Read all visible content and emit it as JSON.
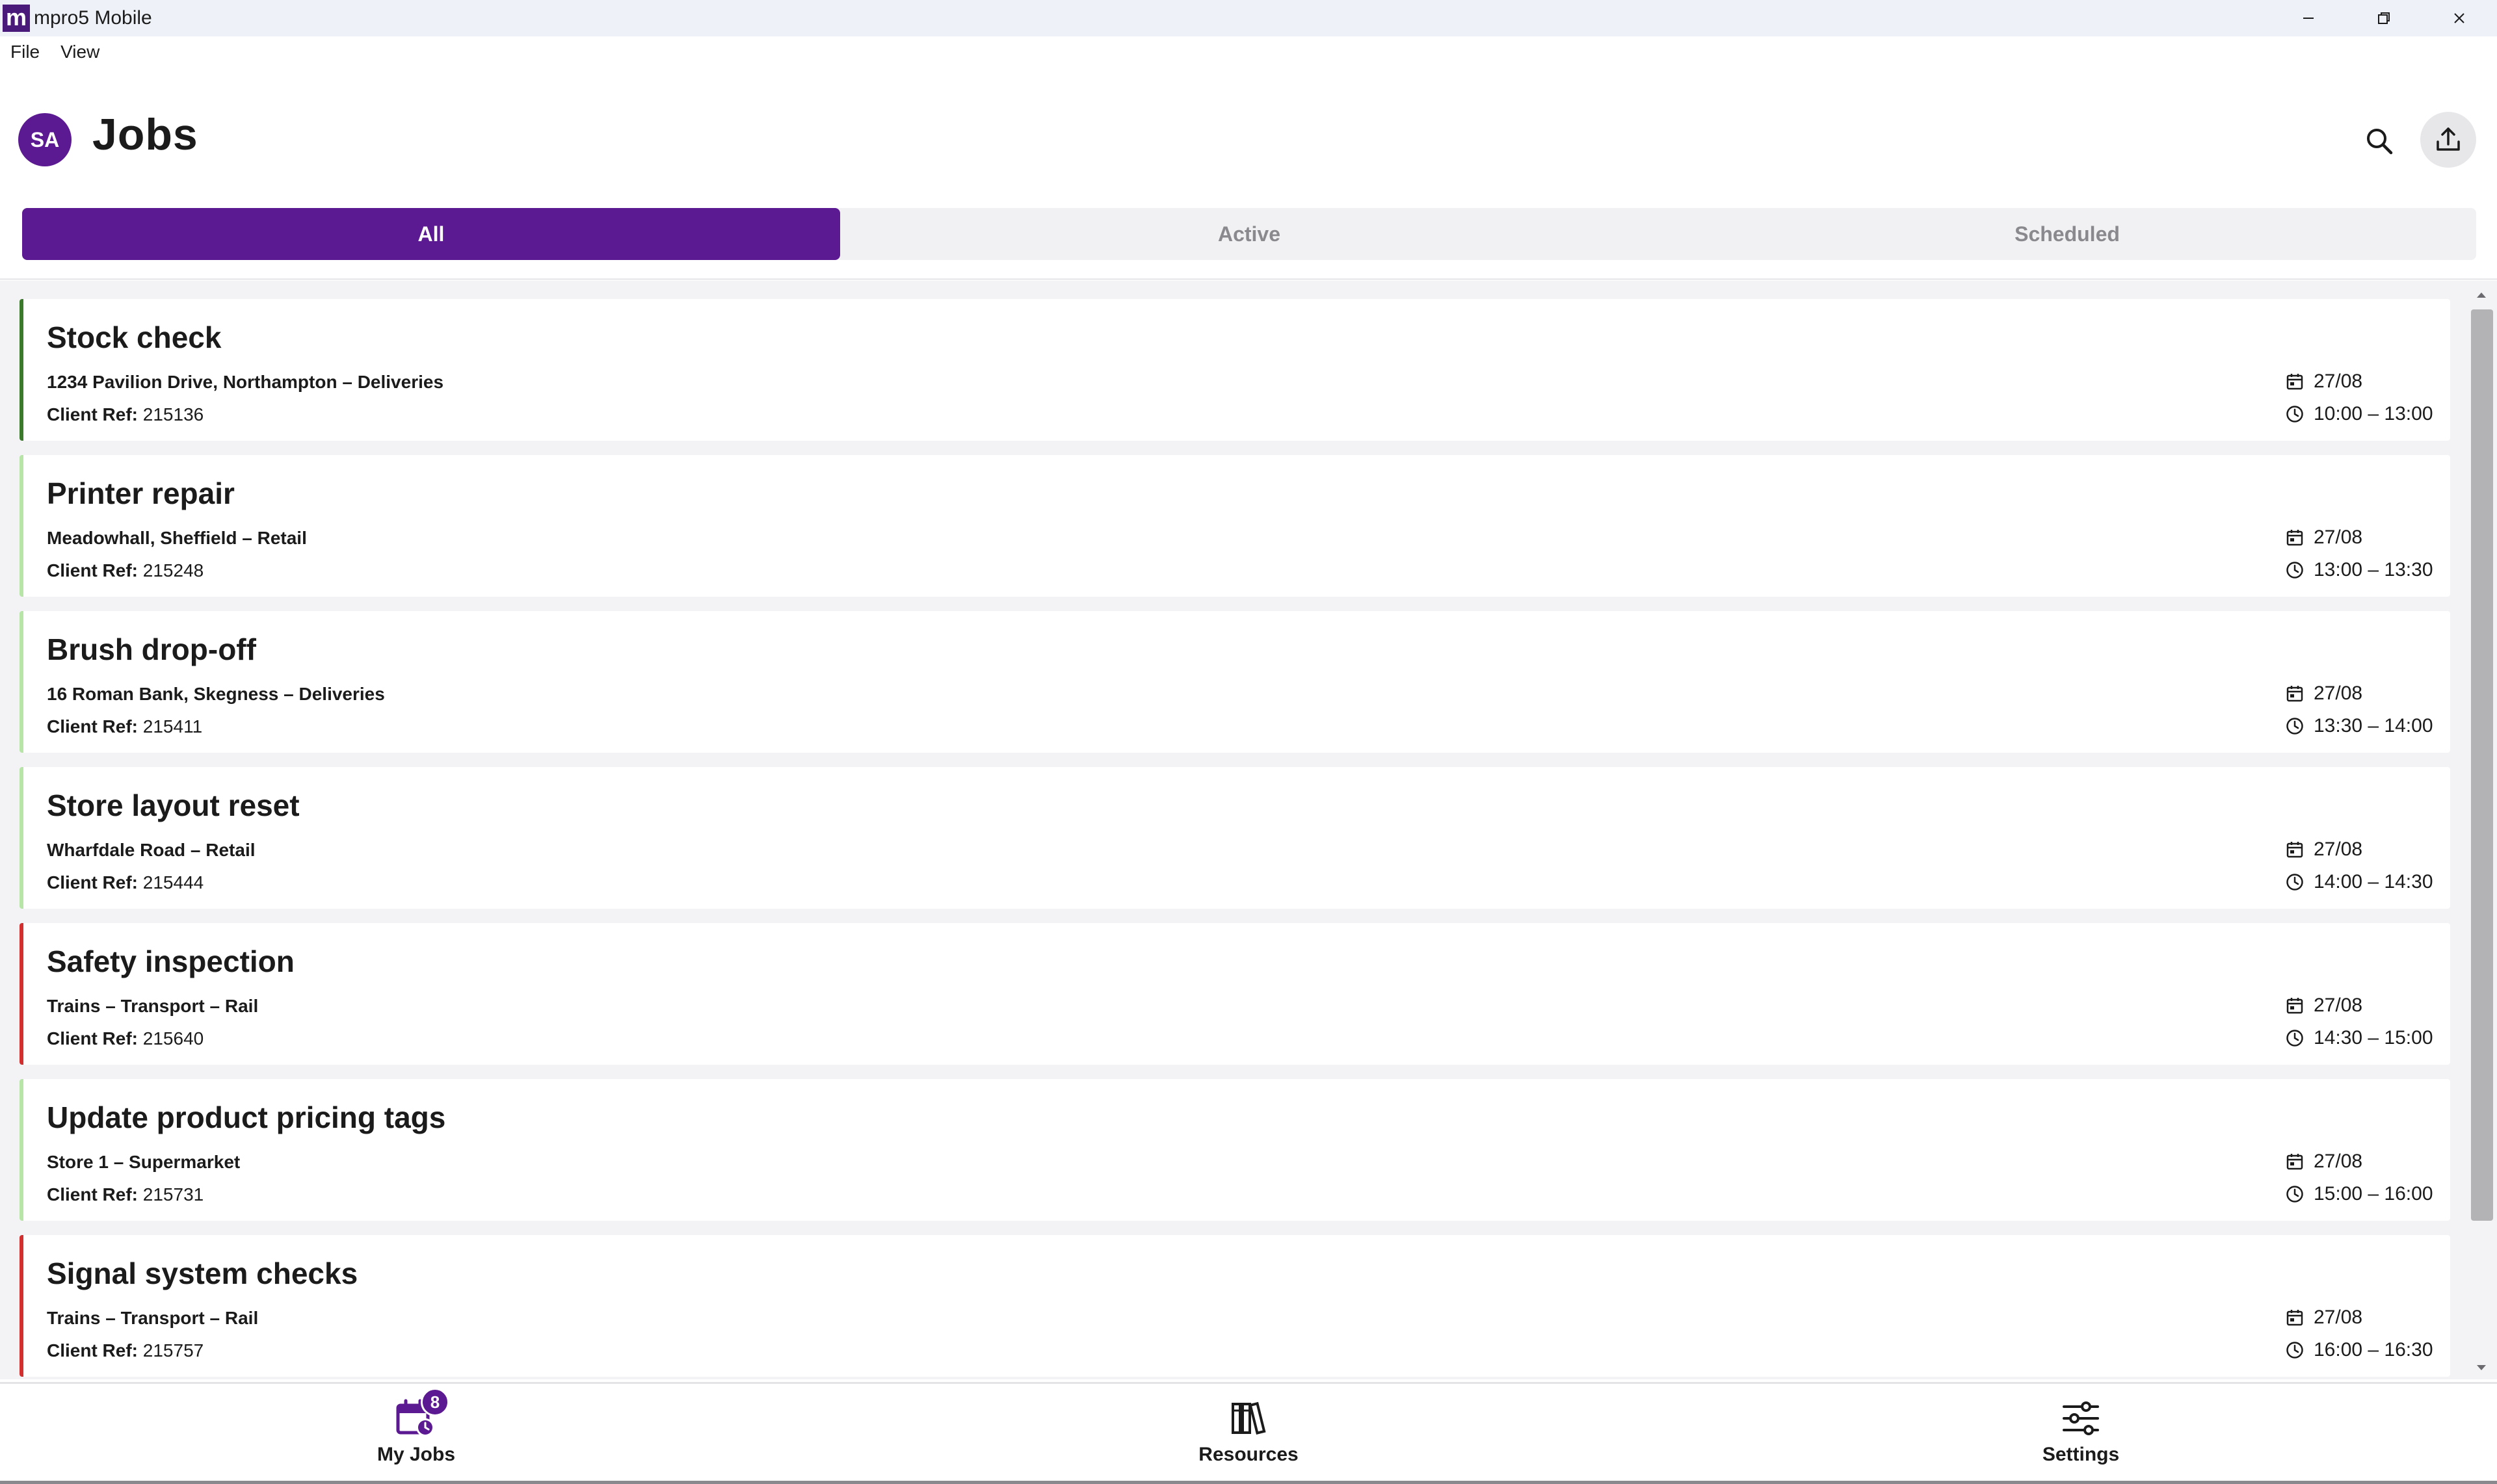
{
  "window": {
    "logo_letter": "m",
    "title": "mpro5 Mobile"
  },
  "menu": [
    "File",
    "View"
  ],
  "header": {
    "avatar_initials": "SA",
    "title": "Jobs"
  },
  "tabs": [
    {
      "label": "All",
      "active": true
    },
    {
      "label": "Active",
      "active": false
    },
    {
      "label": "Scheduled",
      "active": false
    }
  ],
  "client_ref_label": "Client Ref:",
  "jobs": [
    {
      "title": "Stock check",
      "location": "1234 Pavilion Drive, Northampton – Deliveries",
      "client_ref": "215136",
      "date": "27/08",
      "time": "10:00 – 13:00",
      "status_color": "#3a7a2a"
    },
    {
      "title": "Printer repair",
      "location": "Meadowhall, Sheffield – Retail",
      "client_ref": "215248",
      "date": "27/08",
      "time": "13:00 – 13:30",
      "status_color": "#b7e4a7"
    },
    {
      "title": "Brush drop-off",
      "location": "16 Roman Bank, Skegness – Deliveries",
      "client_ref": "215411",
      "date": "27/08",
      "time": "13:30 – 14:00",
      "status_color": "#b7e4a7"
    },
    {
      "title": "Store layout reset",
      "location": "Wharfdale Road – Retail",
      "client_ref": "215444",
      "date": "27/08",
      "time": "14:00 – 14:30",
      "status_color": "#b7e4a7"
    },
    {
      "title": "Safety inspection",
      "location": "Trains – Transport – Rail",
      "client_ref": "215640",
      "date": "27/08",
      "time": "14:30 – 15:00",
      "status_color": "#d32f2f"
    },
    {
      "title": "Update product pricing tags",
      "location": "Store 1 – Supermarket",
      "client_ref": "215731",
      "date": "27/08",
      "time": "15:00 – 16:00",
      "status_color": "#b7e4a7"
    },
    {
      "title": "Signal system checks",
      "location": "Trains – Transport – Rail",
      "client_ref": "215757",
      "date": "27/08",
      "time": "16:00 – 16:30",
      "status_color": "#d32f2f"
    }
  ],
  "bottom_nav": [
    {
      "label": "My Jobs",
      "icon": "calendar-clock-icon",
      "badge": "8",
      "active": true
    },
    {
      "label": "Resources",
      "icon": "books-icon",
      "active": false
    },
    {
      "label": "Settings",
      "icon": "sliders-icon",
      "active": false
    }
  ],
  "colors": {
    "accent": "#5b1a91",
    "status_green_dark": "#3a7a2a",
    "status_green_light": "#b7e4a7",
    "status_red": "#d32f2f"
  }
}
